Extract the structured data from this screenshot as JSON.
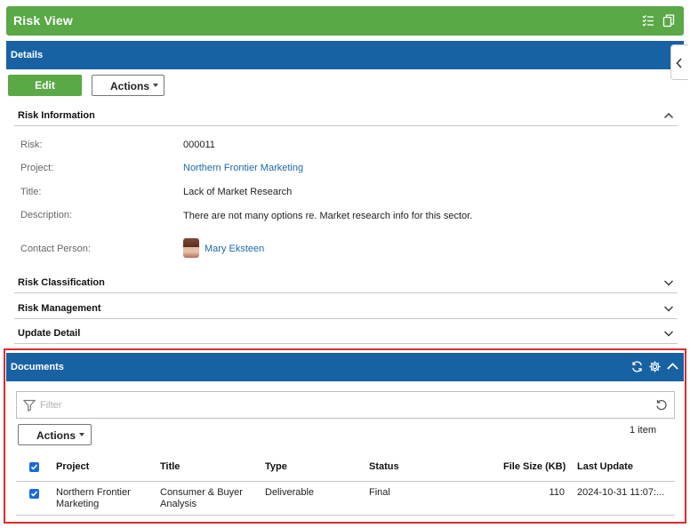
{
  "header": {
    "title": "Risk View"
  },
  "details": {
    "title": "Details",
    "edit_label": "Edit",
    "actions_label": "Actions"
  },
  "risk_information": {
    "title": "Risk Information",
    "fields": {
      "risk_label": "Risk:",
      "risk_value": "000011",
      "project_label": "Project:",
      "project_value": "Northern Frontier Marketing",
      "title_label": "Title:",
      "title_value": "Lack of Market Research",
      "description_label": "Description:",
      "description_value": "There are not many options re. Market research info for this sector.",
      "contact_label": "Contact Person:",
      "contact_value": "Mary Eksteen"
    }
  },
  "sections": {
    "classification": "Risk Classification",
    "management": "Risk Management",
    "update_detail": "Update Detail"
  },
  "documents": {
    "title": "Documents",
    "filter_placeholder": "Filter",
    "actions_label": "Actions",
    "count": "1 item",
    "columns": [
      "Project",
      "Title",
      "Type",
      "Status",
      "File Size (KB)",
      "Last Update"
    ],
    "rows": [
      {
        "project": "Northern Frontier Marketing",
        "title": "Consumer & Buyer Analysis",
        "type": "Deliverable",
        "status": "Final",
        "file_size": "110",
        "last_update": "2024-10-31 11:07:..."
      }
    ]
  },
  "colors": {
    "green": "#5aa846",
    "blue": "#1862a4",
    "link": "#1a6aa8",
    "highlight": "#e02b2b"
  }
}
